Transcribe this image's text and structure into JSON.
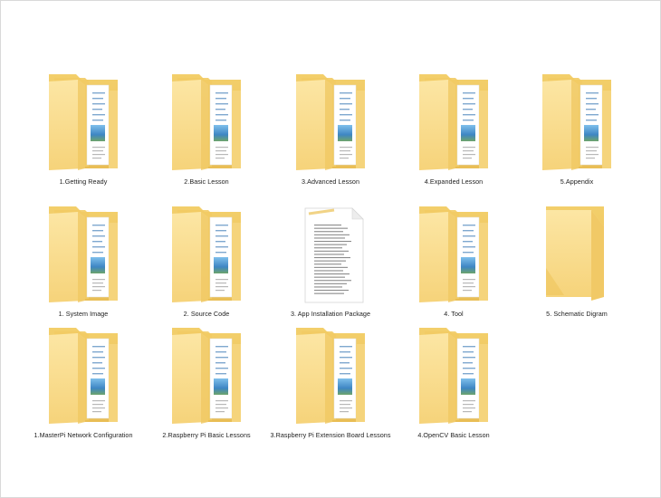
{
  "folders": [
    {
      "label": "1.Getting Ready",
      "icon": "folder-with-documents-icon"
    },
    {
      "label": "2.Basic Lesson",
      "icon": "folder-with-documents-icon"
    },
    {
      "label": "3.Advanced Lesson",
      "icon": "folder-with-documents-icon"
    },
    {
      "label": "4.Expanded Lesson",
      "icon": "folder-with-documents-icon"
    },
    {
      "label": "5.Appendix",
      "icon": "folder-with-documents-icon"
    },
    {
      "label": "1. System Image",
      "icon": "folder-with-documents-icon"
    },
    {
      "label": "2. Source Code",
      "icon": "folder-with-documents-icon"
    },
    {
      "label": "3. App Installation Package",
      "icon": "text-document-icon"
    },
    {
      "label": "4. Tool",
      "icon": "folder-with-documents-icon"
    },
    {
      "label": "5. Schematic Digram",
      "icon": "empty-folder-icon"
    },
    {
      "label": "1.MasterPi Network Configuration",
      "icon": "folder-with-documents-icon"
    },
    {
      "label": "2.Raspberry Pi Basic Lessons",
      "icon": "folder-with-documents-icon"
    },
    {
      "label": "3.Raspberry Pi Extension Board Lessons",
      "icon": "folder-with-documents-icon"
    },
    {
      "label": "4.OpenCV Basic Lesson",
      "icon": "folder-with-documents-icon"
    }
  ],
  "colors": {
    "folder_back": "#EFC85E",
    "folder_front": "#FADD85",
    "folder_front_light": "#FCE59F",
    "paper": "#FFFFFF",
    "photo_blue": "#5A9BCF"
  }
}
